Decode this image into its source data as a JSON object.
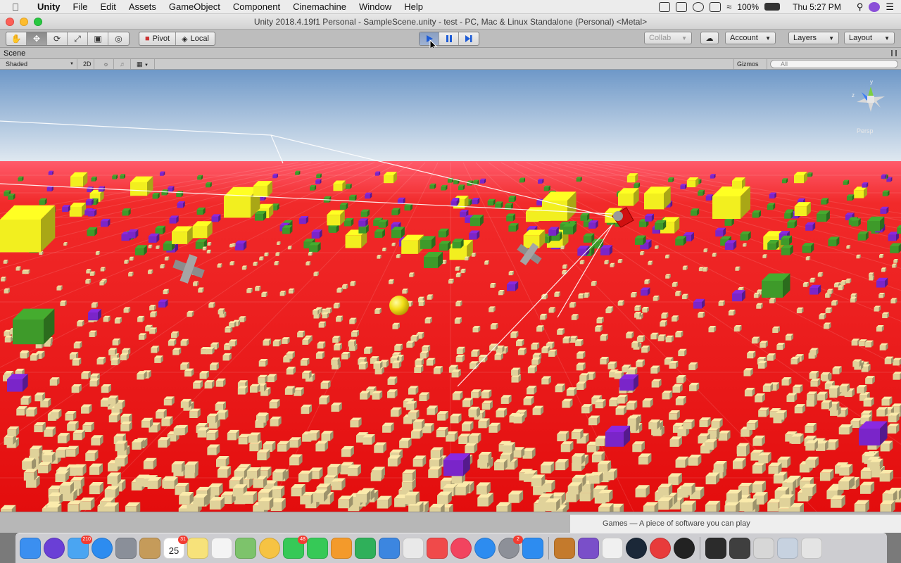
{
  "menubar": {
    "apple_icon": "apple-logo-icon",
    "items": [
      "Unity",
      "File",
      "Edit",
      "Assets",
      "GameObject",
      "Component",
      "Cinemachine",
      "Window",
      "Help"
    ],
    "battery": "100%",
    "clock": "Thu 5:27 PM"
  },
  "window": {
    "title": "Unity 2018.4.19f1 Personal - SampleScene.unity - test - PC, Mac & Linux Standalone (Personal) <Metal>"
  },
  "toolbar": {
    "transform_tools": [
      "hand-tool-icon",
      "move-tool-icon",
      "rotate-tool-icon",
      "scale-tool-icon",
      "rect-tool-icon",
      "transform-tool-icon"
    ],
    "pivot_label": "Pivot",
    "local_label": "Local",
    "collab_label": "Collab",
    "account_label": "Account",
    "layers_label": "Layers",
    "layout_label": "Layout"
  },
  "scene": {
    "tab_label": "Scene",
    "shading_mode": "Shaded",
    "mode_2d": "2D",
    "gizmos_label": "Gizmos",
    "search_placeholder": "All",
    "persp_label": "Persp",
    "gizmo_axis_y": "y",
    "gizmo_axis_z": "z"
  },
  "behind_window": {
    "text": "Games — A piece of software you can play"
  },
  "dock": {
    "apps": [
      {
        "name": "finder",
        "color": "#3b8ff0"
      },
      {
        "name": "siri",
        "color": "#6a3fd6"
      },
      {
        "name": "mail",
        "color": "#4aa5f2",
        "badge": "210"
      },
      {
        "name": "safari",
        "color": "#2d8cf0"
      },
      {
        "name": "launchpad",
        "color": "#8a8f99"
      },
      {
        "name": "contacts",
        "color": "#c59b5a"
      },
      {
        "name": "calendar",
        "color": "#ffffff",
        "badge": "31",
        "label": "25"
      },
      {
        "name": "notes",
        "color": "#f7e27a"
      },
      {
        "name": "reminders",
        "color": "#f4f4f4"
      },
      {
        "name": "maps",
        "color": "#7dc36b"
      },
      {
        "name": "photos",
        "color": "#f6c343"
      },
      {
        "name": "messages",
        "color": "#36c957",
        "badge": "48"
      },
      {
        "name": "facetime",
        "color": "#36c957"
      },
      {
        "name": "pages",
        "color": "#f39a2b"
      },
      {
        "name": "numbers",
        "color": "#2fb05a"
      },
      {
        "name": "keynote",
        "color": "#3c86e0"
      },
      {
        "name": "roblox",
        "color": "#e9e9e9"
      },
      {
        "name": "news",
        "color": "#f04a4a"
      },
      {
        "name": "music",
        "color": "#f2445f"
      },
      {
        "name": "app-store",
        "color": "#2d8cf0"
      },
      {
        "name": "system-preferences",
        "color": "#8d9098",
        "badge": "2"
      },
      {
        "name": "xcode",
        "color": "#2d8cf0"
      },
      {
        "name": "instruments",
        "color": "#c47a2c"
      },
      {
        "name": "visual-studio",
        "color": "#7a4fc9"
      },
      {
        "name": "unity-hub",
        "color": "#f0f0f0"
      },
      {
        "name": "steam",
        "color": "#1b2838"
      },
      {
        "name": "creative-cloud",
        "color": "#e83b3b"
      },
      {
        "name": "unity",
        "color": "#222222"
      },
      {
        "name": "terminal",
        "color": "#2b2b2b"
      },
      {
        "name": "activity-monitor",
        "color": "#3f3f3f"
      },
      {
        "name": "downloads",
        "color": "#d7d7d7"
      },
      {
        "name": "documents",
        "color": "#c7d2e0"
      },
      {
        "name": "trash",
        "color": "#e4e4e4"
      }
    ]
  },
  "colors": {
    "sky_top": "#6e98c8",
    "sky_bottom": "#dfe8f0",
    "ground": "#e81212",
    "green_cube": "#3e9a2a",
    "yellow_cube": "#f2ef1f",
    "purple_cube": "#7a25c9",
    "tan_cube": "#e0d29a"
  }
}
